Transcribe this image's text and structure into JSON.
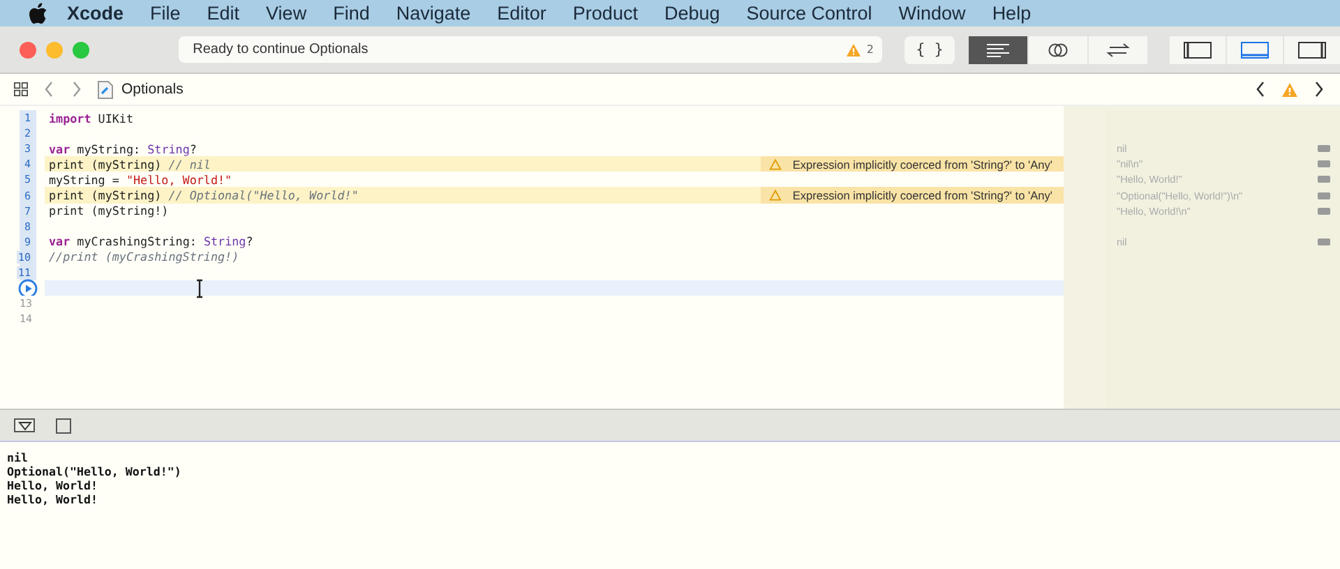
{
  "menu_bar": {
    "items": [
      {
        "label": "Xcode",
        "kind": "app"
      },
      {
        "label": "File",
        "kind": "menu"
      },
      {
        "label": "Edit",
        "kind": "menu"
      },
      {
        "label": "View",
        "kind": "menu"
      },
      {
        "label": "Find",
        "kind": "menu"
      },
      {
        "label": "Navigate",
        "kind": "menu"
      },
      {
        "label": "Editor",
        "kind": "menu"
      },
      {
        "label": "Product",
        "kind": "menu"
      },
      {
        "label": "Debug",
        "kind": "menu"
      },
      {
        "label": "Source Control",
        "kind": "menu"
      },
      {
        "label": "Window",
        "kind": "menu"
      },
      {
        "label": "Help",
        "kind": "menu"
      }
    ]
  },
  "toolbar": {
    "status": "Ready to continue Optionals",
    "warning_count": "2",
    "editor_modes": [
      {
        "kind": "braces",
        "label": "{ }",
        "selected": false
      },
      {
        "kind": "lines",
        "selected": true
      },
      {
        "kind": "rings",
        "selected": false
      },
      {
        "kind": "arrows",
        "selected": false
      }
    ],
    "panels": [
      {
        "kind": "left",
        "selected": false
      },
      {
        "kind": "bottom",
        "selected": true
      },
      {
        "kind": "right",
        "selected": false
      }
    ]
  },
  "jump_bar": {
    "file": "Optionals"
  },
  "editor": {
    "lines": [
      {
        "number": "1",
        "executed": true,
        "tokens": [
          {
            "kind": "keyword",
            "text": "import"
          },
          {
            "kind": "plain",
            "text": " UIKit"
          }
        ]
      },
      {
        "number": "2",
        "executed": true
      },
      {
        "number": "3",
        "executed": true,
        "tokens": [
          {
            "kind": "keyword",
            "text": "var"
          },
          {
            "kind": "plain",
            "text": " myString: "
          },
          {
            "kind": "type",
            "text": "String"
          },
          {
            "kind": "plain",
            "text": "?"
          }
        ],
        "result": "nil"
      },
      {
        "number": "4",
        "executed": true,
        "tokens": [
          {
            "kind": "plain",
            "text": "print (myString) "
          },
          {
            "kind": "comment",
            "text": "// nil"
          }
        ],
        "warning": "Expression implicitly coerced from 'String?' to 'Any'",
        "result": "\"nil\\n\""
      },
      {
        "number": "5",
        "executed": true,
        "tokens": [
          {
            "kind": "plain",
            "text": "myString = "
          },
          {
            "kind": "string",
            "text": "\"Hello, World!\""
          }
        ],
        "result": "\"Hello, World!\""
      },
      {
        "number": "6",
        "executed": true,
        "tokens": [
          {
            "kind": "plain",
            "text": "print (myString) "
          },
          {
            "kind": "comment",
            "text": "// Optional(\"Hello, World!\""
          }
        ],
        "warning": "Expression implicitly coerced from 'String?' to 'Any'",
        "result": "\"Optional(\"Hello, World!\")\\n\""
      },
      {
        "number": "7",
        "executed": true,
        "tokens": [
          {
            "kind": "plain",
            "text": "print (myString!)"
          }
        ],
        "result": "\"Hello, World!\\n\""
      },
      {
        "number": "8",
        "executed": true
      },
      {
        "number": "9",
        "executed": true,
        "tokens": [
          {
            "kind": "keyword",
            "text": "var"
          },
          {
            "kind": "plain",
            "text": " myCrashingString: "
          },
          {
            "kind": "type",
            "text": "String"
          },
          {
            "kind": "plain",
            "text": "?"
          }
        ],
        "result": "nil"
      },
      {
        "number": "10",
        "executed": true,
        "tokens": [
          {
            "kind": "comment",
            "text": "//print (myCrashingString!)"
          }
        ]
      },
      {
        "number": "11",
        "executed": true
      },
      {
        "kind": "run",
        "executed": false,
        "current": true
      },
      {
        "number": "13",
        "executed": false
      },
      {
        "number": "14",
        "executed": false
      }
    ]
  },
  "debug_bar": {
    "checkbox_checked": false
  },
  "console": {
    "lines": [
      "nil",
      "Optional(\"Hello, World!\")",
      "Hello, World!",
      "Hello, World!"
    ]
  }
}
